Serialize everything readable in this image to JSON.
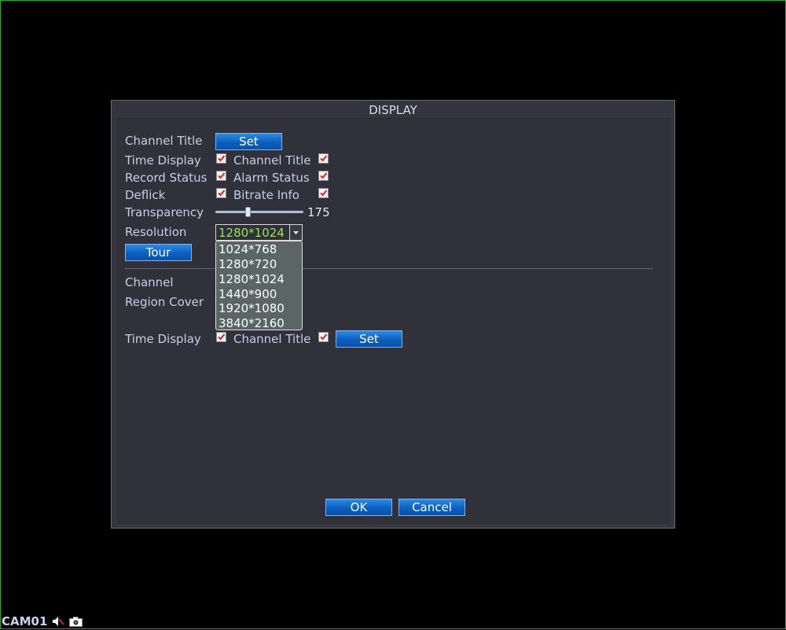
{
  "dialog": {
    "title": "DISPLAY"
  },
  "general": {
    "channel_title_label": "Channel Title",
    "set_label": "Set",
    "time_display_label": "Time Display",
    "time_display_checked": true,
    "channel_title_check_label": "Channel Title",
    "channel_title_checked": true,
    "record_status_label": "Record Status",
    "record_status_checked": true,
    "alarm_status_label": "Alarm Status",
    "alarm_status_checked": true,
    "deflick_label": "Deflick",
    "deflick_checked": true,
    "bitrate_info_label": "Bitrate Info",
    "bitrate_info_checked": true,
    "transparency_label": "Transparency",
    "transparency_value": "175",
    "resolution_label": "Resolution",
    "resolution_value": "1280*1024",
    "resolution_options": [
      "1024*768",
      "1280*720",
      "1280*1024",
      "1440*900",
      "1920*1080",
      "3840*2160"
    ],
    "tour_label": "Tour"
  },
  "channel_section": {
    "channel_label": "Channel",
    "region_cover_label": "Region Cover",
    "time_display_label": "Time Display",
    "time_display_checked": true,
    "channel_title_label": "Channel Title",
    "channel_title_checked": true,
    "set_label": "Set"
  },
  "footer": {
    "ok_label": "OK",
    "cancel_label": "Cancel"
  },
  "status_bar": {
    "camera": "CAM01",
    "icons": [
      "speaker-muted-icon",
      "camera-icon"
    ]
  },
  "colors": {
    "accent_button": "#0c5fbf",
    "selected_value": "#9be35a",
    "check_mark": "#d9252a"
  }
}
